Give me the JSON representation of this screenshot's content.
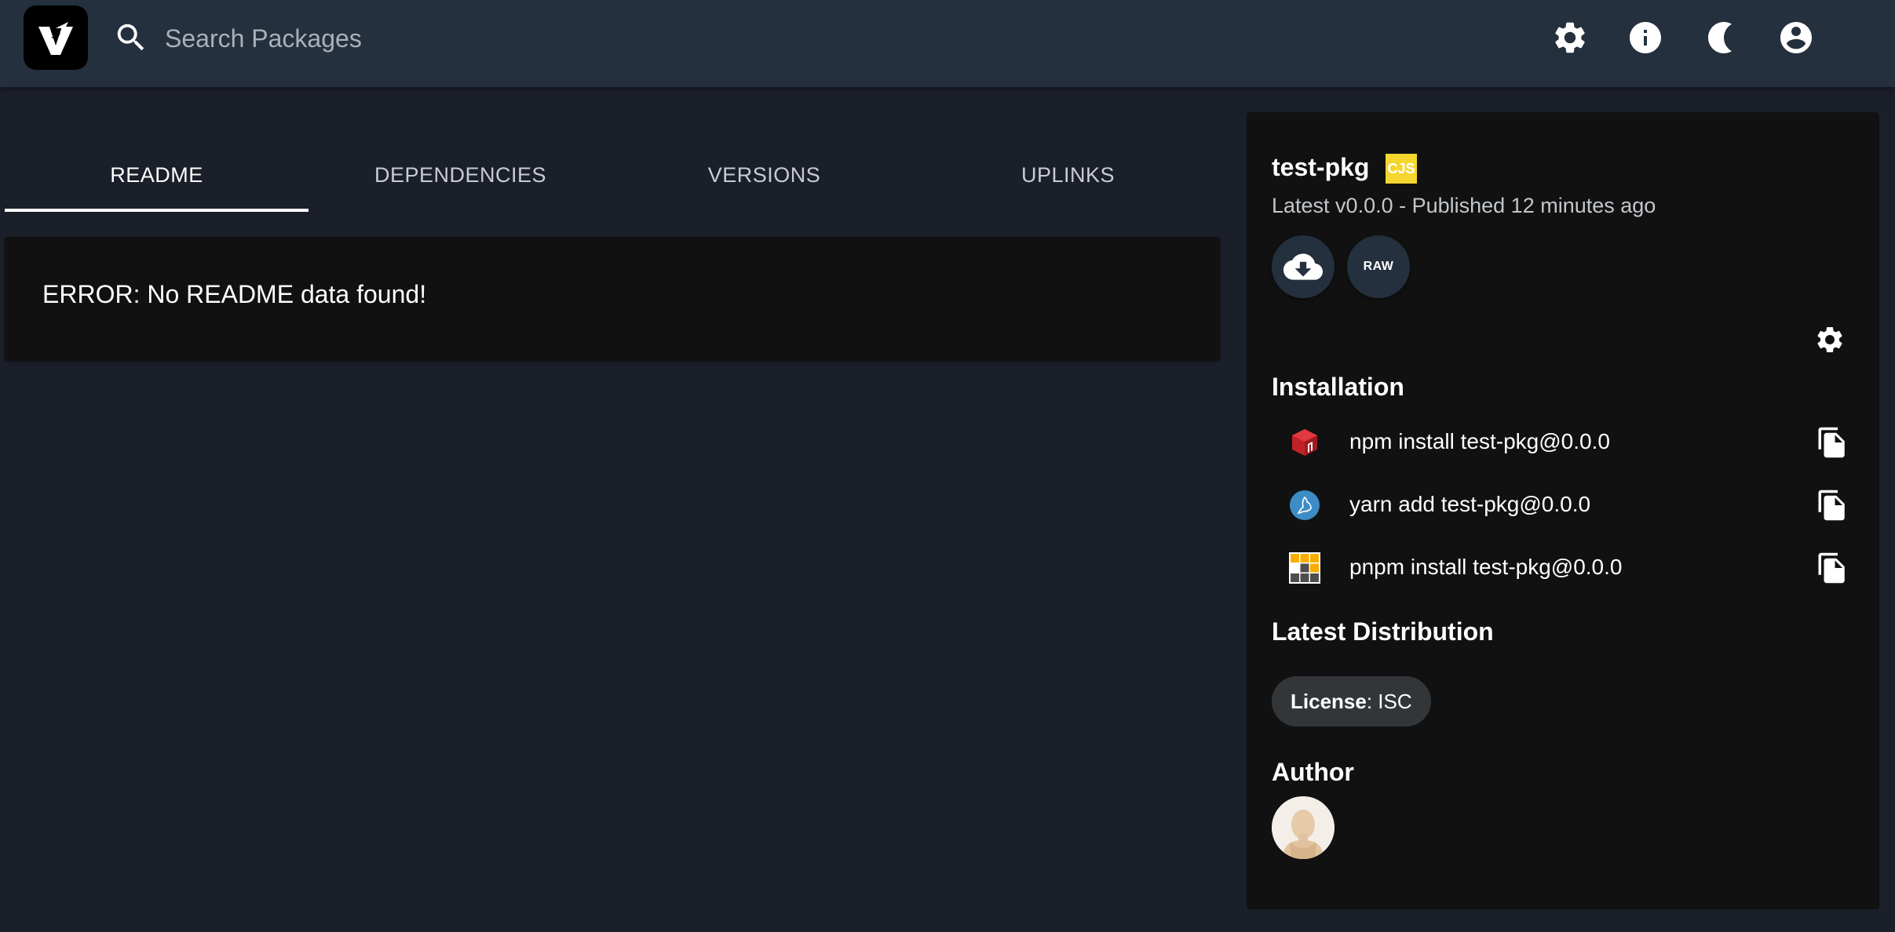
{
  "header": {
    "logo": "verdaccio-logo",
    "search_placeholder": "Search Packages",
    "search_value": "",
    "icons": [
      "gear-icon",
      "info-icon",
      "moon-icon",
      "account-icon"
    ]
  },
  "tabs": [
    {
      "label": "README",
      "active": true
    },
    {
      "label": "DEPENDENCIES",
      "active": false
    },
    {
      "label": "VERSIONS",
      "active": false
    },
    {
      "label": "UPLINKS",
      "active": false
    }
  ],
  "readme": {
    "error_text": "ERROR: No README data found!"
  },
  "sidebar": {
    "package_name": "test-pkg",
    "module_badge": "CJS",
    "subtitle": "Latest v0.0.0 - Published 12 minutes ago",
    "raw_label": "RAW",
    "installation_title": "Installation",
    "install": [
      {
        "manager": "npm",
        "command": "npm install test-pkg@0.0.0",
        "icon": "npm-icon"
      },
      {
        "manager": "yarn",
        "command": "yarn add test-pkg@0.0.0",
        "icon": "yarn-icon"
      },
      {
        "manager": "pnpm",
        "command": "pnpm install test-pkg@0.0.0",
        "icon": "pnpm-icon"
      }
    ],
    "distribution_title": "Latest Distribution",
    "license_label": "License",
    "license_value": "ISC",
    "author_title": "Author"
  },
  "colors": {
    "background": "#1b1f2a",
    "header": "#24303d",
    "card": "#111111",
    "badge_yellow": "#f5d62f",
    "npm_red": "#c12127",
    "yarn_blue": "#2c8ebb",
    "pnpm_orange": "#f9ad00"
  }
}
